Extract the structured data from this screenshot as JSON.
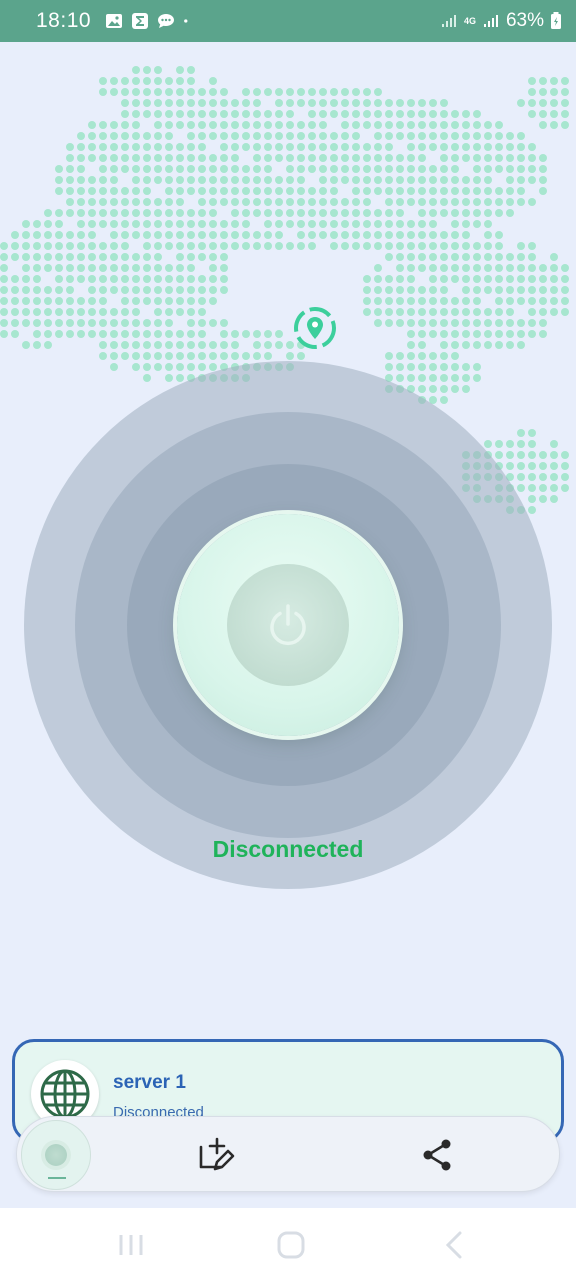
{
  "status_bar": {
    "time": "18:10",
    "network": "4G",
    "battery": "63%"
  },
  "connection": {
    "status": "Disconnected",
    "status_color": "#1fb35a"
  },
  "server": {
    "name": "server 1",
    "status": "Disconnected"
  },
  "colors": {
    "status_bar": "#5ba48c",
    "accent_green": "#3ccf9c",
    "map_dots": "#a7e6cf",
    "card_border": "#3567b5"
  },
  "icons": {
    "power": "power-icon",
    "location": "location-pin-icon",
    "globe": "globe-icon",
    "edit": "add-edit-icon",
    "share": "share-icon"
  }
}
